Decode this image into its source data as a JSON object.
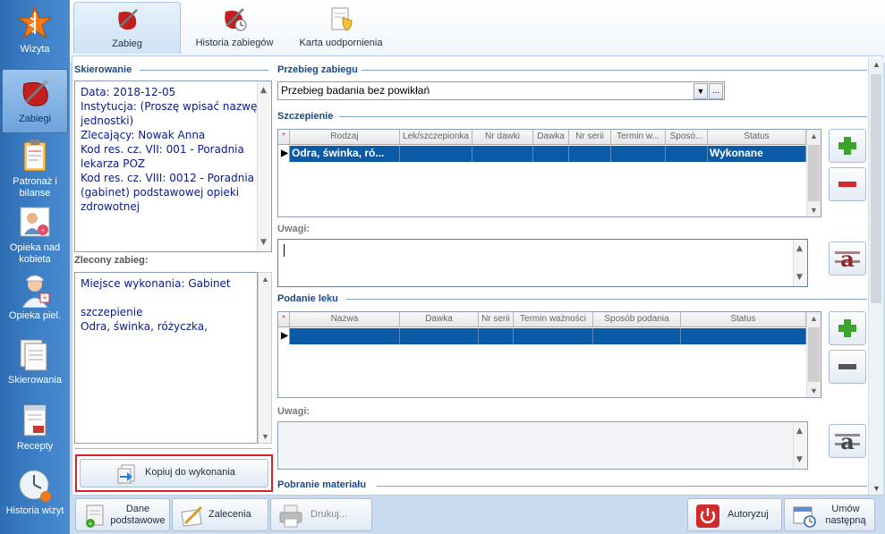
{
  "nav": {
    "items": [
      {
        "label": "Wizyta",
        "icon": "caduceus-star-icon"
      },
      {
        "label": "Zabiegi",
        "icon": "drop-needle-icon",
        "active": true
      },
      {
        "label": "Patronaż i bilanse",
        "icon": "clipboard-icon"
      },
      {
        "label": "Opieka nad kobieta",
        "icon": "woman-card-icon"
      },
      {
        "label": "Opieka piel.",
        "icon": "nurse-icon"
      },
      {
        "label": "Skierowania",
        "icon": "documents-icon"
      },
      {
        "label": "Recepty",
        "icon": "prescription-icon"
      },
      {
        "label": "Historia wizyt",
        "icon": "clock-history-icon"
      }
    ]
  },
  "tabs": [
    {
      "label": "Zabieg",
      "icon": "procedure-icon",
      "active": true
    },
    {
      "label": "Historia zabiegów",
      "icon": "procedure-history-icon"
    },
    {
      "label": "Karta uodpornienia",
      "icon": "immunization-card-icon"
    }
  ],
  "referral": {
    "title": "Skierowanie",
    "lines": [
      "Data: 2018-12-05",
      "Instytucja: (Proszę wpisać nazwę",
      "jednostki)",
      "Zlecający: Nowak Anna",
      "Kod res. cz. VII: 001 - Poradnia",
      "lekarza POZ",
      "Kod res. cz. VIII: 0012 - Poradnia",
      "(gabinet) podstawowej opieki",
      "zdrowotnej"
    ]
  },
  "ordered": {
    "title": "Zlecony zabieg:",
    "lines": [
      "Miejsce wykonania: Gabinet",
      "",
      "szczepienie",
      "Odra, świnka, różyczka,"
    ]
  },
  "copy_button": "Kopiuj do wykonania",
  "course": {
    "title": "Przebieg zabiegu",
    "value": "Przebieg badania bez powikłań",
    "more": "..."
  },
  "vaccination": {
    "title": "Szczepienie",
    "columns": [
      "Rodzaj",
      "Lek/szczepionka",
      "Nr dawki",
      "Dawka",
      "Nr serii",
      "Termin w...",
      "Sposó...",
      "Status"
    ],
    "rows": [
      [
        "Odra, świnka, ró...",
        "",
        "",
        "",
        "",
        "",
        "",
        "Wykonane"
      ]
    ],
    "notes_label": "Uwagi:"
  },
  "drug": {
    "title": "Podanie leku",
    "columns": [
      "Nazwa",
      "Dawka",
      "Nr serii",
      "Termin ważności",
      "Sposób podania",
      "Status"
    ],
    "notes_label": "Uwagi:"
  },
  "sample": {
    "title": "Pobranie materiału"
  },
  "marker": "*",
  "row_pointer": "▶",
  "bottom": {
    "basic": "Dane podstawowe",
    "recommendations": "Zalecenia",
    "print": "Drukuj...",
    "authorize": "Autoryzuj",
    "next": "Umów następną"
  },
  "colors": {
    "accent": "#0b5aa6",
    "section": "#1a4a86",
    "highlight_border": "#d9202a"
  }
}
